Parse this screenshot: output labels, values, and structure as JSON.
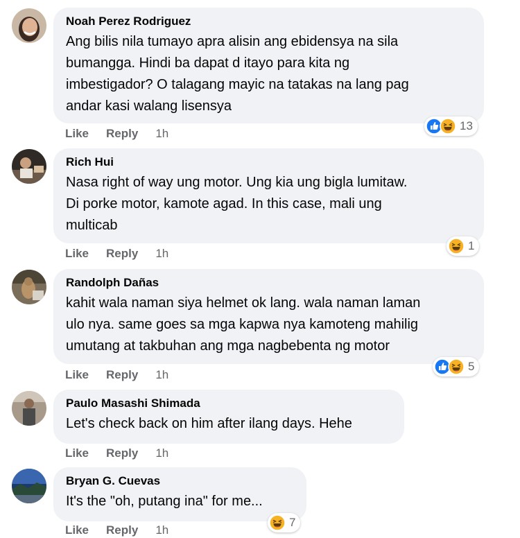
{
  "comments": [
    {
      "author": "Noah Perez Rodriguez",
      "text": "Ang bilis nila tumayo apra alisin ang ebidensya na sila\nbumangga. Hindi ba dapat d itayo para kita ng\nimbestigador? O talagang mayic na tatakas na lang pag\nandar kasi walang lisensya",
      "like_label": "Like",
      "reply_label": "Reply",
      "time": "1h",
      "reactions": [
        "like-icon",
        "haha-icon"
      ],
      "reaction_count": "13"
    },
    {
      "author": "Rich Hui",
      "text": "Nasa right of way ung motor. Ung kia ung bigla lumitaw.\nDi porke motor, kamote agad. In this case, mali ung\nmulticab",
      "like_label": "Like",
      "reply_label": "Reply",
      "time": "1h",
      "reactions": [
        "haha-icon"
      ],
      "reaction_count": "1"
    },
    {
      "author": "Randolph Dañas",
      "text": "kahit wala naman siya helmet ok lang. wala naman laman\nulo nya. same goes sa mga kapwa nya kamoteng mahilig\numutang at takbuhan ang mga nagbebenta ng motor",
      "like_label": "Like",
      "reply_label": "Reply",
      "time": "1h",
      "reactions": [
        "like-icon",
        "haha-icon"
      ],
      "reaction_count": "5"
    },
    {
      "author": "Paulo Masashi Shimada",
      "text": "Let's check back on him after ilang days. Hehe",
      "like_label": "Like",
      "reply_label": "Reply",
      "time": "1h"
    },
    {
      "author": "Bryan G. Cuevas",
      "text": "It's the \"oh, putang ina\" for me...",
      "like_label": "Like",
      "reply_label": "Reply",
      "time": "1h",
      "reactions": [
        "haha-icon"
      ],
      "reaction_count": "7"
    }
  ],
  "colors": {
    "bubble": "#f0f2f5",
    "like_blue": "#1877f2",
    "haha_yellow": "#f7b125",
    "meta_gray": "#65676b"
  }
}
